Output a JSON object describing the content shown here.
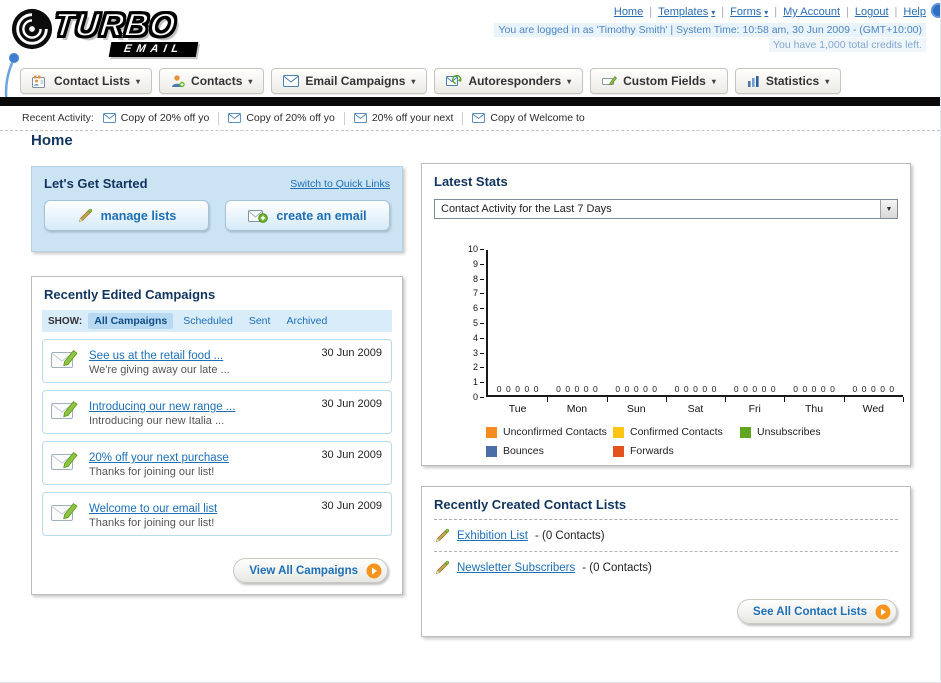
{
  "page": {
    "title": "Home"
  },
  "header": {
    "logo": {
      "main": "TURBO",
      "sub": "EMAIL"
    },
    "nav": [
      {
        "label": "Home",
        "dropdown": false
      },
      {
        "label": "Templates",
        "dropdown": true
      },
      {
        "label": "Forms",
        "dropdown": true
      },
      {
        "label": "My Account",
        "dropdown": false
      },
      {
        "label": "Logout",
        "dropdown": false
      },
      {
        "label": "Help",
        "dropdown": false
      }
    ],
    "login_line": "You are logged in as 'Timothy Smith' | System Time: 10:58 am, 30 Jun 2009 - (GMT+10:00)",
    "credits_line": "You have 1,000 total credits left."
  },
  "main_nav": [
    {
      "label": "Contact Lists",
      "icon": "contact-lists-icon"
    },
    {
      "label": "Contacts",
      "icon": "contacts-icon"
    },
    {
      "label": "Email Campaigns",
      "icon": "email-campaigns-icon"
    },
    {
      "label": "Autoresponders",
      "icon": "autoresponders-icon"
    },
    {
      "label": "Custom Fields",
      "icon": "custom-fields-icon"
    },
    {
      "label": "Statistics",
      "icon": "statistics-icon"
    }
  ],
  "recent_activity": {
    "label": "Recent Activity:",
    "items": [
      "Copy of 20% off yo",
      "Copy of 20% off yo",
      "20% off your next",
      "Copy of Welcome to"
    ]
  },
  "get_started": {
    "title": "Let's Get Started",
    "switch_link": "Switch to Quick Links",
    "buttons": [
      {
        "label": "manage lists",
        "icon": "pencil-icon"
      },
      {
        "label": "create an email",
        "icon": "envelope-plus-icon"
      }
    ]
  },
  "campaigns": {
    "title": "Recently Edited Campaigns",
    "show_label": "SHOW:",
    "tabs": [
      {
        "label": "All Campaigns",
        "selected": true
      },
      {
        "label": "Scheduled",
        "selected": false
      },
      {
        "label": "Sent",
        "selected": false
      },
      {
        "label": "Archived",
        "selected": false
      }
    ],
    "items": [
      {
        "title": "See us at the retail food ...",
        "subtitle": "We're giving away our late ...",
        "date": "30 Jun 2009"
      },
      {
        "title": "Introducing our new range ...",
        "subtitle": "Introducing our new Italia ...",
        "date": "30 Jun 2009"
      },
      {
        "title": "20% off your next purchase",
        "subtitle": "Thanks for joining our list!",
        "date": "30 Jun 2009"
      },
      {
        "title": "Welcome to our email list",
        "subtitle": "Thanks for joining our list!",
        "date": "30 Jun 2009"
      }
    ],
    "view_all_label": "View All Campaigns"
  },
  "stats": {
    "title": "Latest Stats",
    "dropdown_value": "Contact Activity for the Last 7 Days"
  },
  "chart_data": {
    "type": "bar",
    "title": "Contact Activity for the Last 7 Days",
    "categories": [
      "Tue",
      "Mon",
      "Sun",
      "Sat",
      "Fri",
      "Thu",
      "Wed"
    ],
    "series": [
      {
        "name": "Unconfirmed Contacts",
        "color": "#f68b1f",
        "values": [
          0,
          0,
          0,
          0,
          0,
          0,
          0
        ]
      },
      {
        "name": "Confirmed Contacts",
        "color": "#fdc411",
        "values": [
          0,
          0,
          0,
          0,
          0,
          0,
          0
        ]
      },
      {
        "name": "Unsubscribes",
        "color": "#61a621",
        "values": [
          0,
          0,
          0,
          0,
          0,
          0,
          0
        ]
      },
      {
        "name": "Bounces",
        "color": "#4a6fa8",
        "values": [
          0,
          0,
          0,
          0,
          0,
          0,
          0
        ]
      },
      {
        "name": "Forwards",
        "color": "#e2531f",
        "values": [
          0,
          0,
          0,
          0,
          0,
          0,
          0
        ]
      }
    ],
    "ylim": [
      0,
      10
    ],
    "ytick_step": 1,
    "grid": false,
    "legend_position": "bottom",
    "value_labels_shown": true
  },
  "contact_lists": {
    "title": "Recently Created Contact Lists",
    "items": [
      {
        "name": "Exhibition List",
        "detail": "- (0 Contacts)"
      },
      {
        "name": "Newsletter Subscribers",
        "detail": "- (0 Contacts)"
      }
    ],
    "see_all_label": "See All Contact Lists"
  }
}
